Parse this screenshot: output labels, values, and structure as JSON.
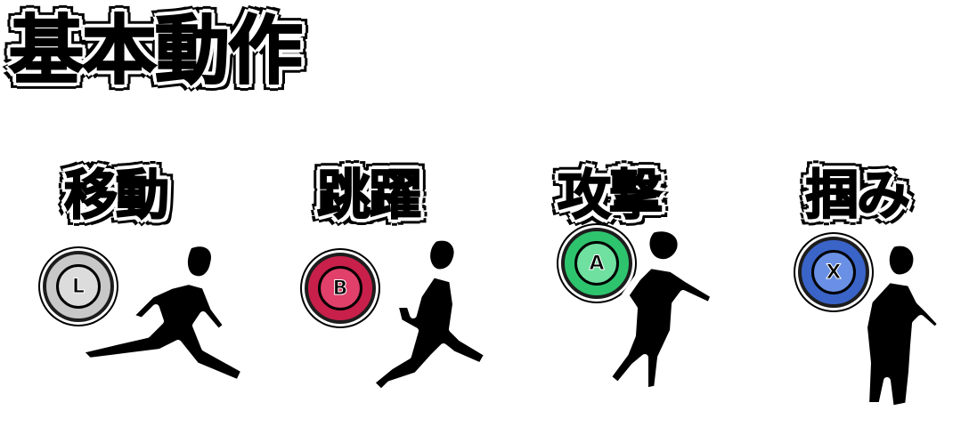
{
  "page": {
    "title": "基本動作"
  },
  "actions": [
    {
      "label": "移動",
      "button": "L",
      "button_color": "#c8c8c8",
      "inner_color": "#dcdcdc",
      "figure": "running-silhouette-icon"
    },
    {
      "label": "跳躍",
      "button": "B",
      "button_color": "#c8204a",
      "inner_color": "#e0406a",
      "figure": "jumping-silhouette-icon"
    },
    {
      "label": "攻撃",
      "button": "A",
      "button_color": "#2ec46e",
      "inner_color": "#6fe0a0",
      "figure": "attacking-silhouette-icon"
    },
    {
      "label": "掴み",
      "button": "X",
      "button_color": "#3a64c8",
      "inner_color": "#6a90e6",
      "figure": "grabbing-silhouette-icon"
    }
  ]
}
